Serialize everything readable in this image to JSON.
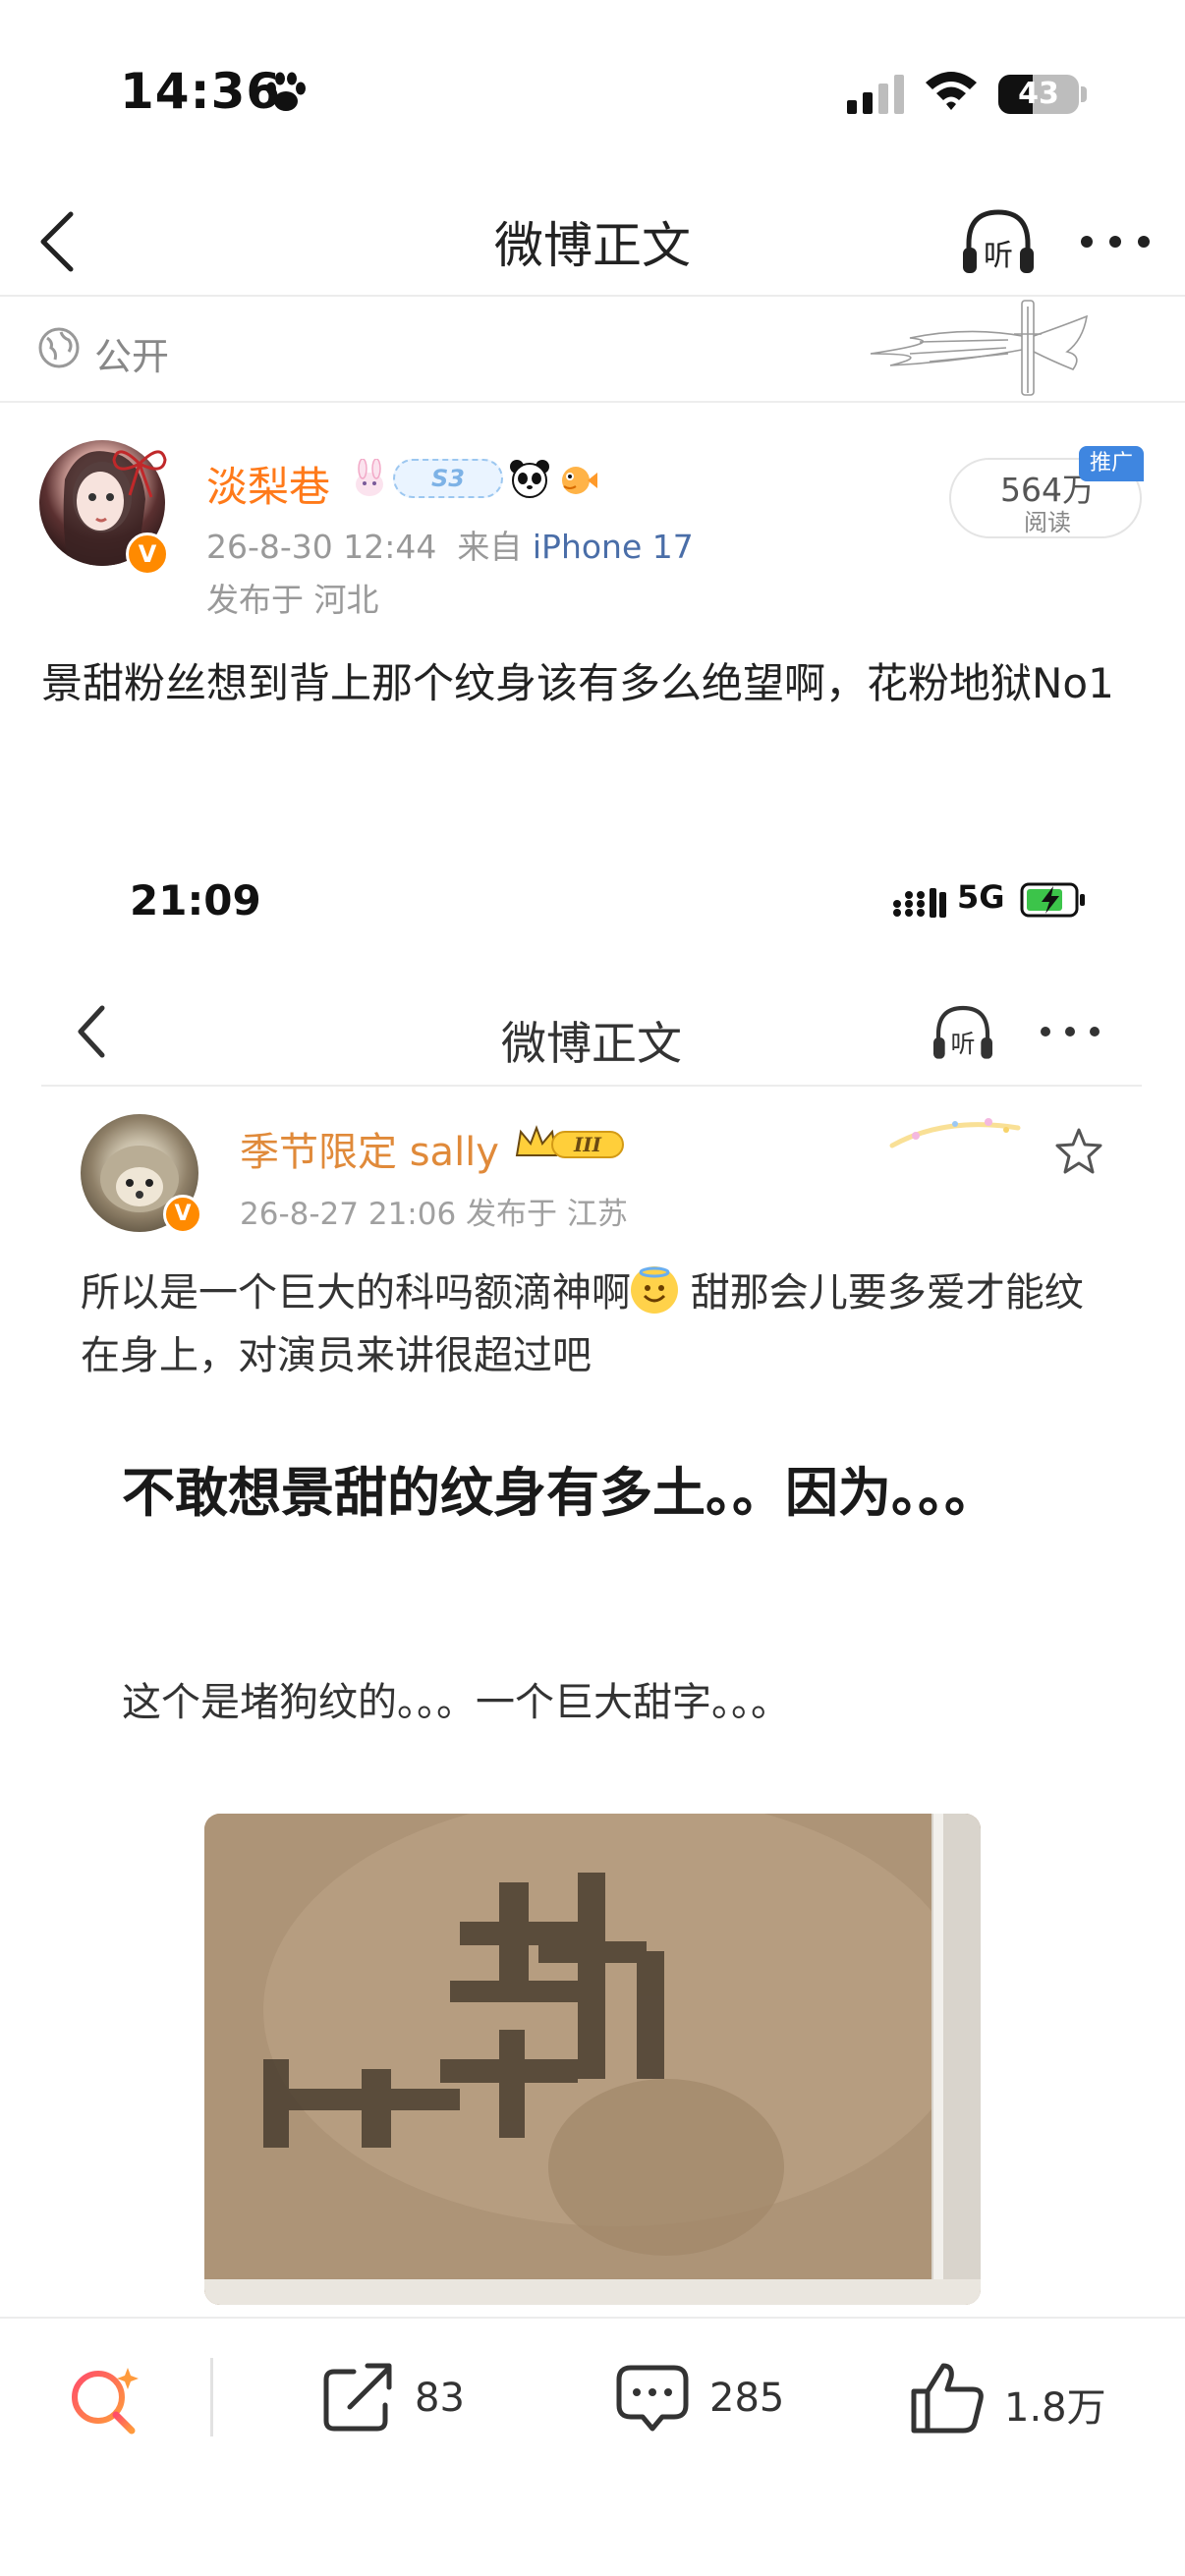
{
  "status_bar": {
    "time": "14:36",
    "battery": "43",
    "battery_fraction": 0.43
  },
  "nav": {
    "title": "微博正文",
    "listen_label": "听"
  },
  "visibility": {
    "label": "公开"
  },
  "post": {
    "author_name": "淡梨巷",
    "level_badge": "S3",
    "time": "26-8-30 12:44",
    "source_prefix": "来自",
    "device": "iPhone 17",
    "location": "发布于 河北",
    "reads_count": "564万",
    "reads_label": "阅读",
    "promo_tag": "推广",
    "verified_mark": "V",
    "text": "景甜粉丝想到背上那个纹身该有多么绝望啊，花粉地狱No1"
  },
  "embedded": {
    "time": "21:09",
    "network": "5G",
    "nav_title": "微博正文",
    "listen_label": "听",
    "author_name": "季节限定 sally",
    "crown_level": "III",
    "meta": "26-8-27 21:06  发布于 江苏",
    "verified_mark": "V",
    "text_before_emoji": "所以是一个巨大的科吗额滴神啊",
    "text_after_emoji": " 甜那会儿要多爱才能纹在身上，对演员来讲很超过吧",
    "headline": "不敢想景甜的纹身有多土。。因为。。。",
    "subtext": "这个是堵狗纹的。。。一个巨大甜字。。。"
  },
  "actions": {
    "repost_count": "83",
    "comment_count": "285",
    "like_count": "1.8万"
  },
  "colors": {
    "accent_orange": "#ff7a1a",
    "link_blue": "#4a6ea8",
    "promo_blue": "#3f86e0",
    "search_gradient_start": "#ff4d6a",
    "search_gradient_end": "#ff9a3c"
  }
}
